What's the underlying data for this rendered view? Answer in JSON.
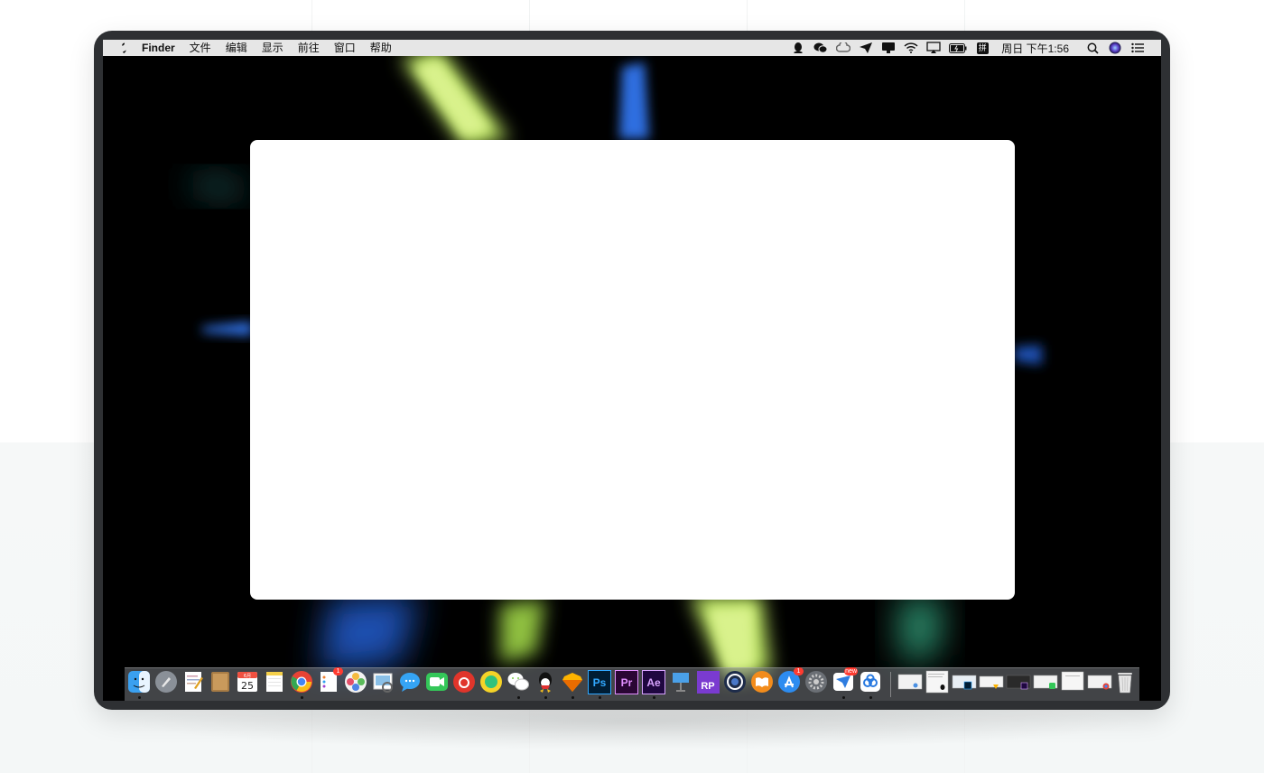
{
  "menubar": {
    "items": [
      "Finder",
      "文件",
      "编辑",
      "显示",
      "前往",
      "窗口",
      "帮助"
    ],
    "status_icons": [
      "qq-icon",
      "wechat-icon",
      "creative-cloud-icon",
      "paper-plane-icon",
      "display-icon",
      "wifi-icon",
      "airplay-icon",
      "battery-icon",
      "input-method-icon"
    ],
    "input_method": "拼",
    "clock": "周日 下午1:56",
    "right_icons": [
      "search-icon",
      "siri-icon",
      "notification-center-icon"
    ]
  },
  "dock": {
    "apps": [
      {
        "name": "finder-icon",
        "running": true
      },
      {
        "name": "launchpad-icon",
        "running": false
      },
      {
        "name": "textedit-icon",
        "running": false
      },
      {
        "name": "contacts-icon",
        "running": false
      },
      {
        "name": "calendar-icon",
        "label": "25",
        "month": "6月",
        "running": false
      },
      {
        "name": "notes-icon",
        "running": false
      },
      {
        "name": "chrome-icon",
        "running": true
      },
      {
        "name": "reminders-icon",
        "badge": "1",
        "running": false
      },
      {
        "name": "photos-icon",
        "running": false
      },
      {
        "name": "preview-icon",
        "running": false
      },
      {
        "name": "messages-icon",
        "running": false
      },
      {
        "name": "facetime-icon",
        "running": false
      },
      {
        "name": "netease-music-icon",
        "running": false
      },
      {
        "name": "qq-music-icon",
        "running": false
      },
      {
        "name": "wechat-icon",
        "running": true
      },
      {
        "name": "qq-icon",
        "running": true
      },
      {
        "name": "sketch-icon",
        "running": true
      },
      {
        "name": "photoshop-icon",
        "label": "Ps",
        "running": true
      },
      {
        "name": "premiere-icon",
        "label": "Pr",
        "running": false
      },
      {
        "name": "after-effects-icon",
        "label": "Ae",
        "running": true
      },
      {
        "name": "keynote-icon",
        "running": false
      },
      {
        "name": "axure-icon",
        "label": "RP",
        "running": false
      },
      {
        "name": "cinema4d-icon",
        "running": false
      },
      {
        "name": "books-icon",
        "running": false
      },
      {
        "name": "app-store-icon",
        "badge": "1",
        "running": false
      },
      {
        "name": "system-preferences-icon",
        "running": false
      },
      {
        "name": "feishu-icon",
        "badge": "new",
        "running": true
      },
      {
        "name": "baidu-netdisk-icon",
        "running": true
      }
    ],
    "minimized": [
      "window-thumbnail-icon",
      "window-thumbnail-icon",
      "window-thumbnail-icon",
      "window-thumbnail-icon",
      "window-thumbnail-icon",
      "window-thumbnail-icon",
      "window-thumbnail-icon",
      "window-thumbnail-icon"
    ],
    "trash": "trash-icon"
  },
  "colors": {
    "device_frame": "#2e3033",
    "menubar": "#e6e6e6",
    "window": "#ffffff",
    "wallpaper_green": "#b8e060",
    "wallpaper_blue": "#2f6ee0"
  }
}
